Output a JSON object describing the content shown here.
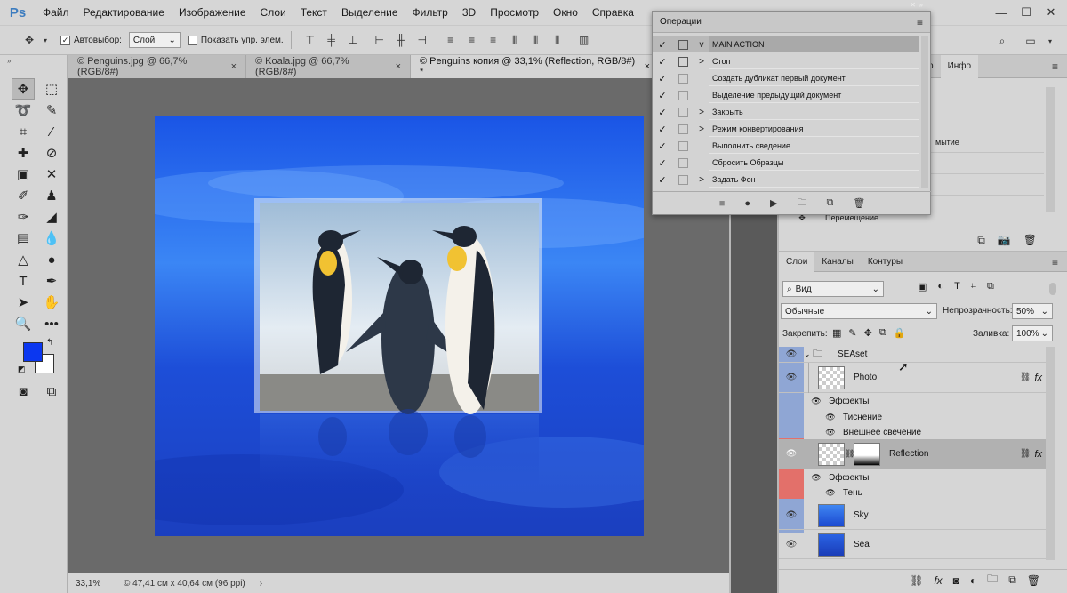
{
  "app": {
    "logo": "Ps"
  },
  "menu": [
    "Файл",
    "Редактирование",
    "Изображение",
    "Слои",
    "Текст",
    "Выделение",
    "Фильтр",
    "3D",
    "Просмотр",
    "Окно",
    "Справка"
  ],
  "options": {
    "autoselect_label": "Автовыбор:",
    "autoselect_value": "Слой",
    "show_transform_label": "Показать упр. элем."
  },
  "tabs": [
    {
      "label": "© Penguins.jpg @ 66,7% (RGB/8#)"
    },
    {
      "label": "© Koala.jpg @ 66,7% (RGB/8#)"
    },
    {
      "label": "© Penguins копия @ 33,1% (Reflection, RGB/8#) *"
    }
  ],
  "status": {
    "zoom": "33,1%",
    "docinfo": "© 47,41 см x 40,64 см (96 ppi)"
  },
  "operations": {
    "title": "Операции",
    "items": [
      {
        "checked": true,
        "name": "MAIN ACTION",
        "expand": "v",
        "header": true
      },
      {
        "checked": true,
        "name": "Стоп",
        "expand": ">"
      },
      {
        "checked": true,
        "name": "Создать дубликат первый документ",
        "expand": ""
      },
      {
        "checked": true,
        "name": "Выделение  предыдущий документ",
        "expand": ""
      },
      {
        "checked": true,
        "name": "Закрыть",
        "expand": ">"
      },
      {
        "checked": true,
        "name": "Режим конвертирования",
        "expand": ">"
      },
      {
        "checked": true,
        "name": "Выполнить сведение",
        "expand": ""
      },
      {
        "checked": true,
        "name": "Сбросить Образцы",
        "expand": ""
      },
      {
        "checked": true,
        "name": "Задать Фон",
        "expand": ">"
      }
    ]
  },
  "history": {
    "tabs": [
      "тор",
      "Инфо"
    ],
    "partial_item": "мытие",
    "item_move": "Перемещение"
  },
  "layers": {
    "tabs": [
      "Слои",
      "Каналы",
      "Контуры"
    ],
    "filter": "Вид",
    "blend": "Обычные",
    "opacity_label": "Непрозрачность:",
    "opacity": "50%",
    "lock_label": "Закрепить:",
    "fill_label": "Заливка:",
    "fill": "100%",
    "items": [
      {
        "name": "SEAset"
      },
      {
        "name": "Photo"
      },
      {
        "name": "Эффекты"
      },
      {
        "name": "Тиснение"
      },
      {
        "name": "Внешнее свечение"
      },
      {
        "name": "Reflection"
      },
      {
        "name": "Эффекты"
      },
      {
        "name": "Тень"
      },
      {
        "name": "Sky"
      },
      {
        "name": "Sea"
      }
    ]
  }
}
